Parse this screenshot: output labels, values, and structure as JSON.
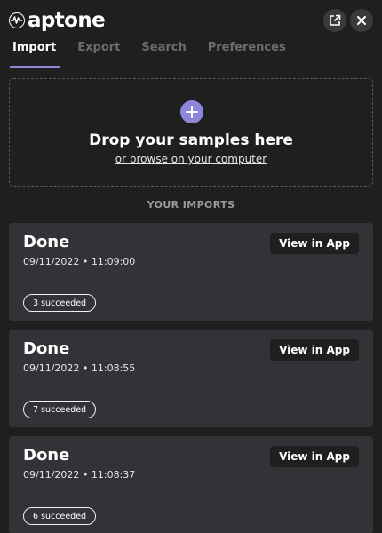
{
  "brand": {
    "name": "aptone"
  },
  "header": {
    "external_icon": "external-link-icon",
    "close_icon": "close-icon"
  },
  "tabs": [
    {
      "label": "Import",
      "active": true
    },
    {
      "label": "Export",
      "active": false
    },
    {
      "label": "Search",
      "active": false
    },
    {
      "label": "Preferences",
      "active": false
    }
  ],
  "dropzone": {
    "icon": "plus-icon",
    "title": "Drop your samples here",
    "link": "or browse on your computer"
  },
  "imports_heading": "YOUR IMPORTS",
  "imports": [
    {
      "status": "Done",
      "timestamp": "09/11/2022 • 11:09:00",
      "result": "3 succeeded",
      "action": "View in App"
    },
    {
      "status": "Done",
      "timestamp": "09/11/2022 • 11:08:55",
      "result": "7 succeeded",
      "action": "View in App"
    },
    {
      "status": "Done",
      "timestamp": "09/11/2022 • 11:08:37",
      "result": "6 succeeded",
      "action": "View in App"
    }
  ],
  "colors": {
    "accent": "#8e87d9",
    "background": "#1f1f1f",
    "card": "#333237"
  }
}
